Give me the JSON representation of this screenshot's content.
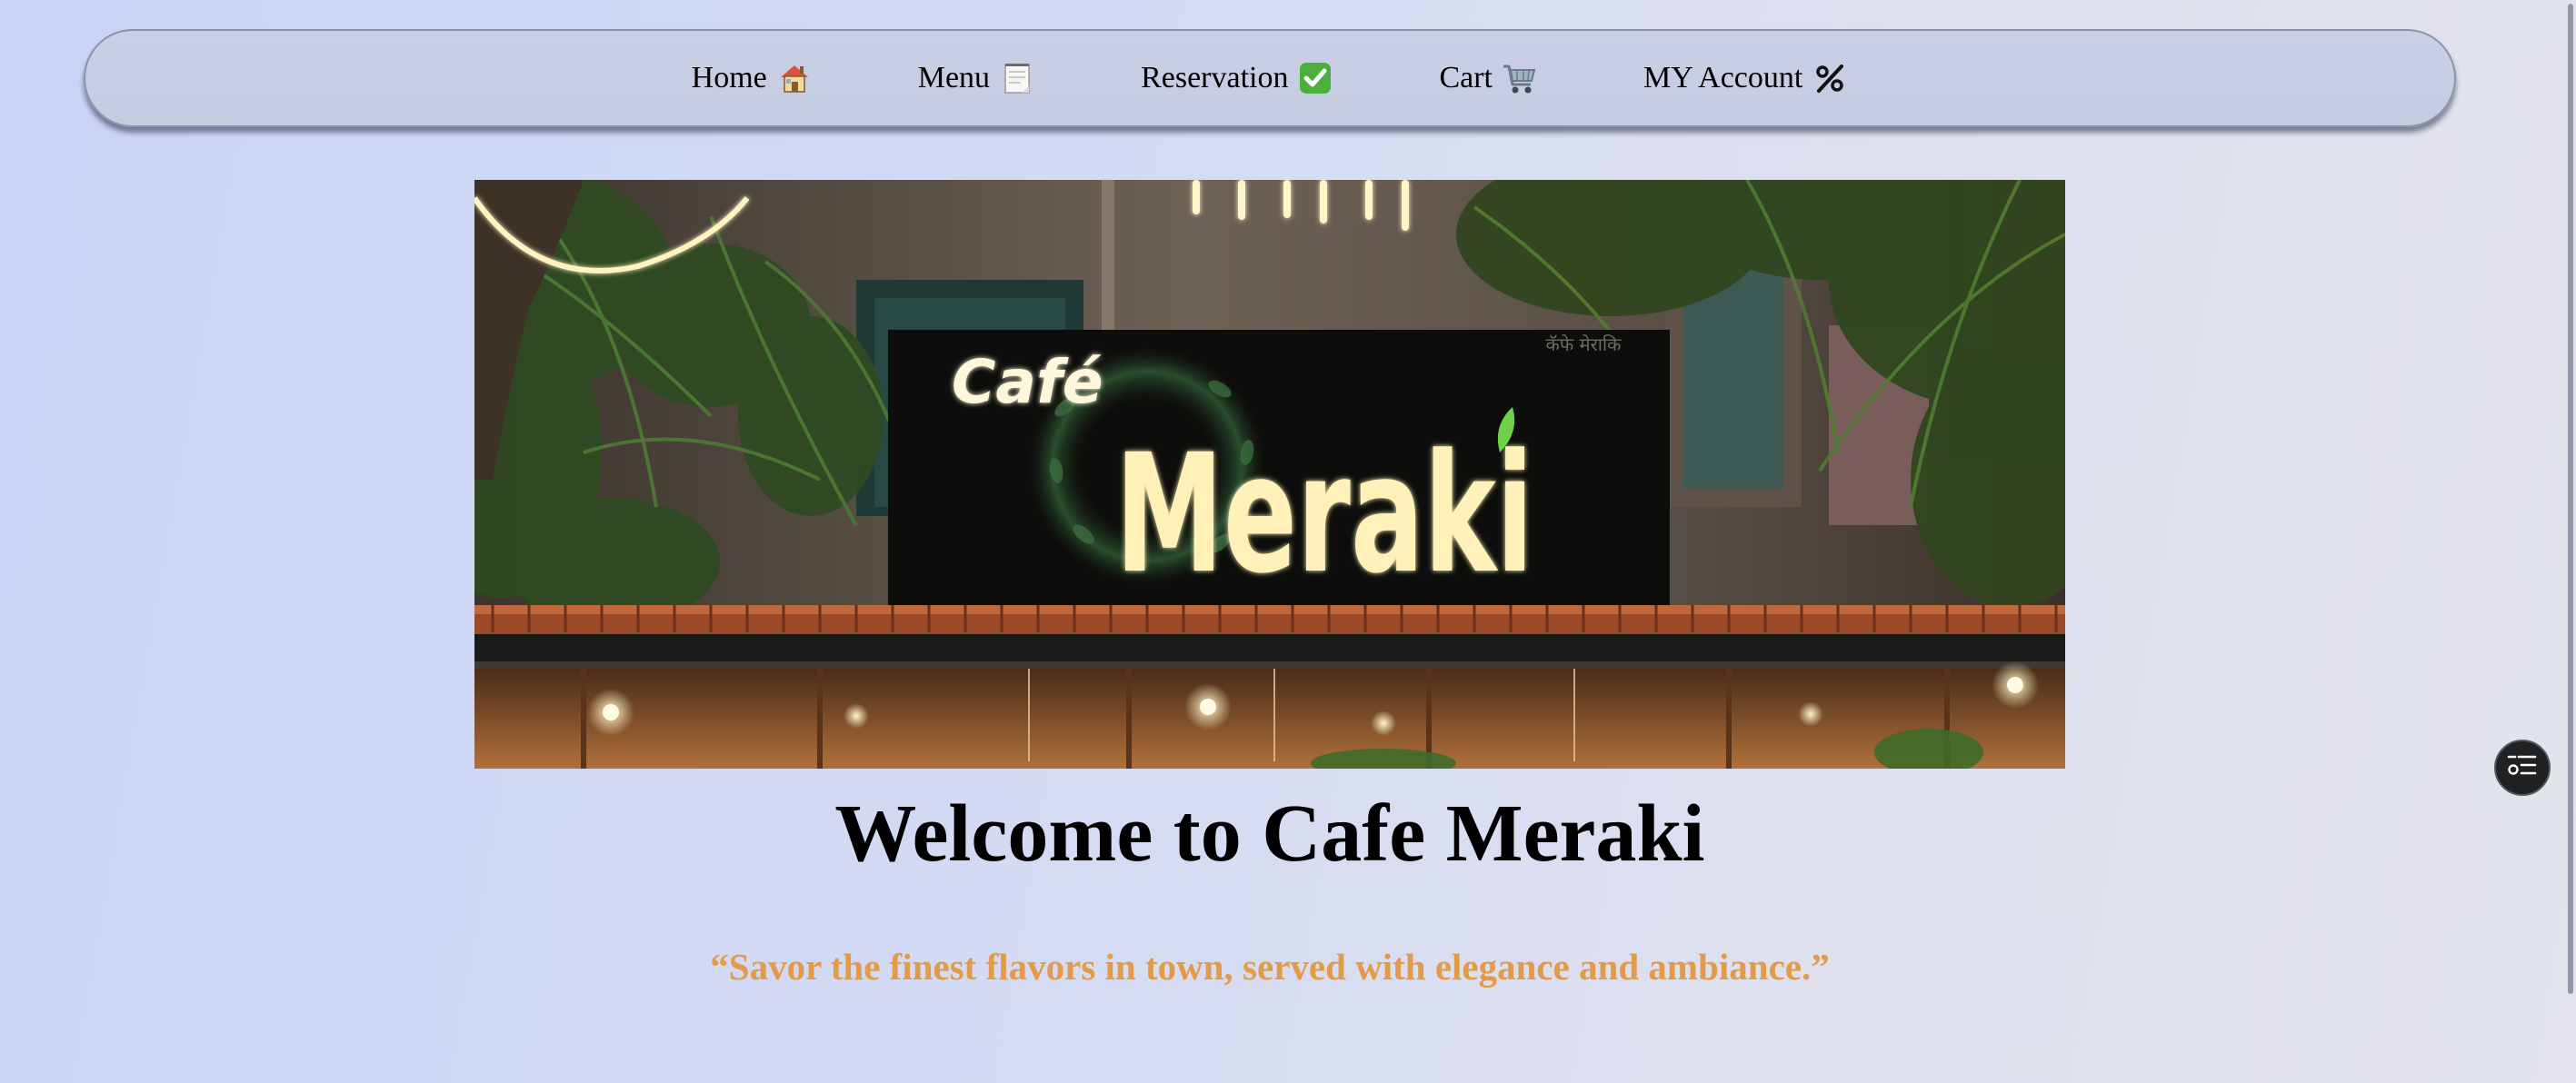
{
  "nav": {
    "items": [
      {
        "label": "Home",
        "icon": "house-icon",
        "glyph": "🏠"
      },
      {
        "label": "Menu",
        "icon": "notepad-icon",
        "glyph": "🗒"
      },
      {
        "label": "Reservation",
        "icon": "check-mark-icon",
        "glyph": "✅"
      },
      {
        "label": "Cart",
        "icon": "shopping-cart-icon",
        "glyph": "🛒"
      },
      {
        "label": "MY Account",
        "icon": "percent-icon",
        "glyph": "%"
      }
    ]
  },
  "hero": {
    "sign_text_small": "Café",
    "sign_text_large": "Meraki",
    "sign_text_devanagari": "कॅफे मेराकि"
  },
  "welcome": {
    "title": "Welcome to Cafe Meraki",
    "tagline": "“Savor the finest flavors in town, served with elegance and ambiance.”"
  },
  "widget": {
    "icon": "settings-list-icon"
  },
  "colors": {
    "nav_background": "#c7cee4",
    "tagline": "#e29b48",
    "title": "#000000",
    "sign_text": "#fff4c6",
    "leaf_accent": "#6fd14a"
  }
}
